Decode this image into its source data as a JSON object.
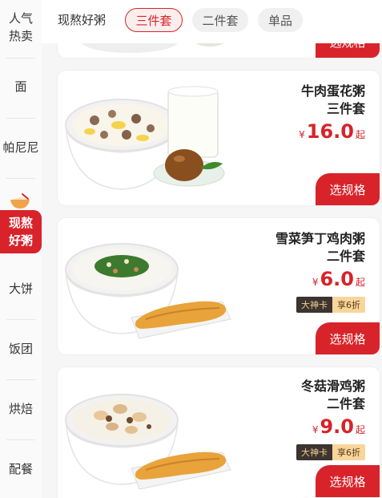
{
  "sidebar": {
    "items": [
      {
        "label": "人气",
        "label2": "热卖"
      },
      {
        "label": "面"
      },
      {
        "label": "帕尼尼"
      },
      {
        "label": "现熬",
        "label2": "好粥"
      },
      {
        "label": "大饼"
      },
      {
        "label": "饭团"
      },
      {
        "label": "烘焙"
      },
      {
        "label": "配餐"
      }
    ]
  },
  "subtabs": {
    "section": "现熬好粥",
    "chips": [
      {
        "label": "三件套",
        "active": true
      },
      {
        "label": "二件套",
        "active": false
      },
      {
        "label": "单品",
        "active": false
      }
    ]
  },
  "products": [
    {
      "button": "选规格"
    },
    {
      "name": "牛肉蛋花粥",
      "set": "三件套",
      "currency": "¥",
      "price": "16.0",
      "suffix": "起",
      "button": "选规格"
    },
    {
      "name": "雪菜笋丁鸡肉粥",
      "set": "二件套",
      "currency": "¥",
      "price": "6.0",
      "suffix": "起",
      "vip": "大神卡",
      "discount": "享6折",
      "button": "选规格"
    },
    {
      "name": "冬菇滑鸡粥",
      "set": "二件套",
      "currency": "¥",
      "price": "9.0",
      "suffix": "起",
      "vip": "大神卡",
      "discount": "享6折",
      "button": "选规格"
    }
  ],
  "colors": {
    "accent": "#d8232a",
    "vip_dark": "#3b3430",
    "vip_gold": "#f7d59b"
  }
}
